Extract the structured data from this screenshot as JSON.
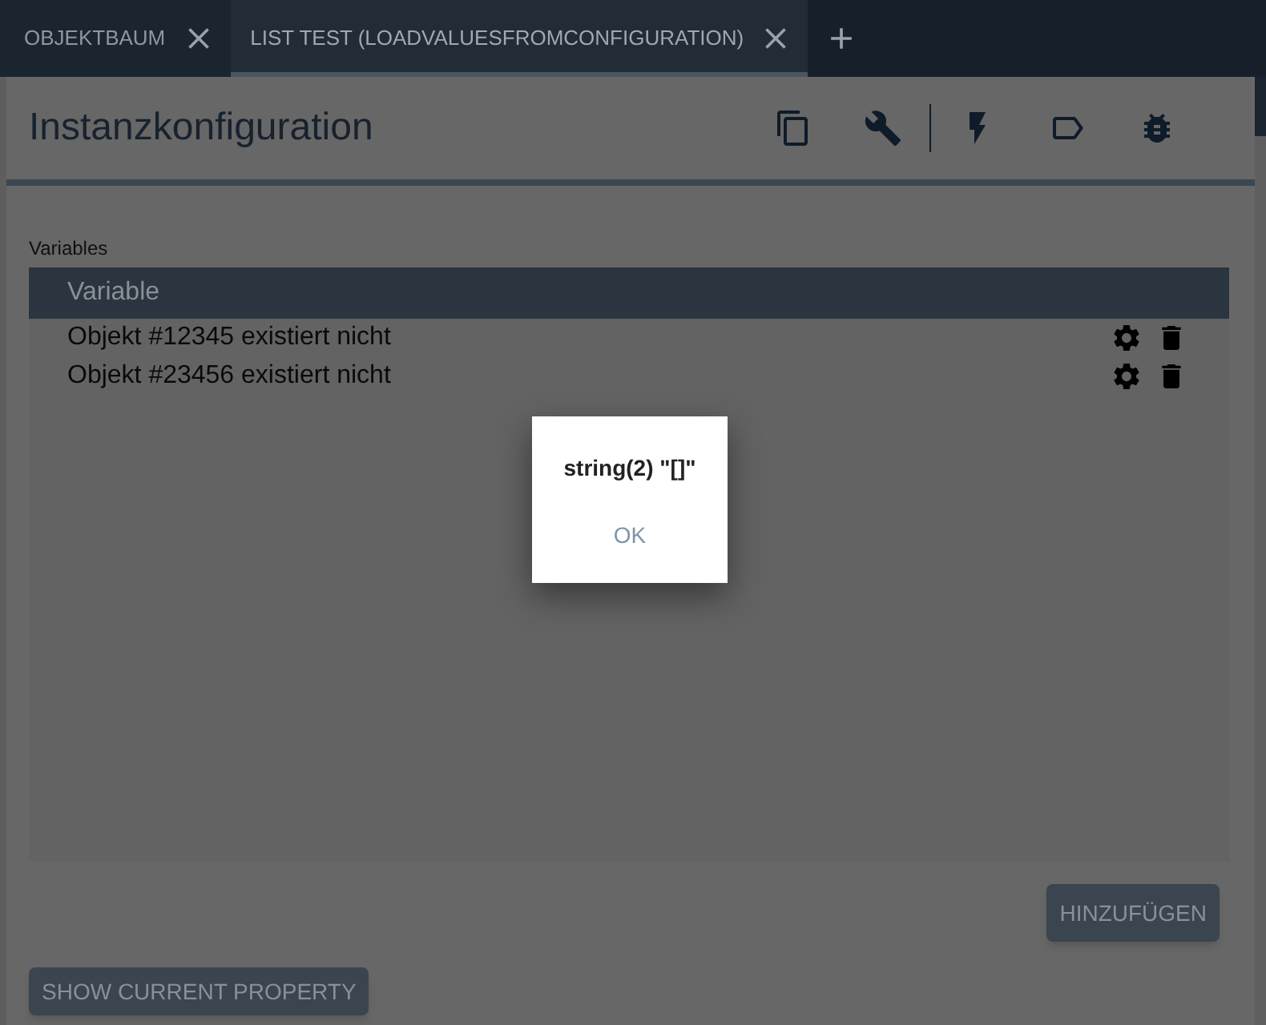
{
  "tabs": [
    {
      "label": "OBJEKTBAUM",
      "selected": false
    },
    {
      "label": "LIST TEST (LOADVALUESFROMCONFIGURATION)",
      "selected": true
    }
  ],
  "panel": {
    "title": "Instanzkonfiguration"
  },
  "variables": {
    "label": "Variables",
    "columns": [
      "Variable"
    ],
    "rows": [
      {
        "text": "Objekt #12345 existiert nicht"
      },
      {
        "text": "Objekt #23456 existiert nicht"
      }
    ],
    "add_button": "HINZUFÜGEN"
  },
  "show_button": "SHOW CURRENT PROPERTY",
  "dialog": {
    "message": "string(2) \"[]\"",
    "button": "OK"
  }
}
